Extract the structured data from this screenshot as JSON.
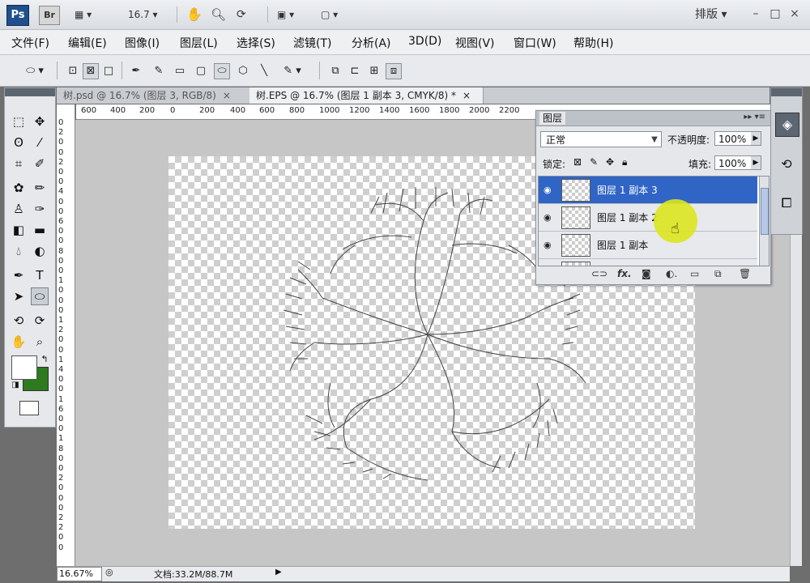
{
  "appbar": {
    "ps_label": "Ps",
    "br_label": "Br",
    "zoom": "16.7",
    "workspace": "排版",
    "win_min": "–",
    "win_max": "□",
    "win_close": "×"
  },
  "menu": [
    "文件(F)",
    "编辑(E)",
    "图像(I)",
    "图层(L)",
    "选择(S)",
    "滤镜(T)",
    "分析(A)",
    "3D(D)",
    "视图(V)",
    "窗口(W)",
    "帮助(H)"
  ],
  "tabs": [
    {
      "label": "树.psd @ 16.7% (图层 3, RGB/8)",
      "close": "×"
    },
    {
      "label": "树.EPS @ 16.7% (图层 1 副本 3, CMYK/8) *",
      "close": "×"
    }
  ],
  "ruler_top": [
    "600",
    "400",
    "200",
    "0",
    "200",
    "400",
    "600",
    "800",
    "1000",
    "1200",
    "1400",
    "1600",
    "1800",
    "2000",
    "2200"
  ],
  "ruler_left": [
    "0",
    "2",
    "0",
    "0",
    "2",
    "0",
    "0",
    "4",
    "0",
    "0",
    "6",
    "0",
    "0",
    "8",
    "0",
    "0",
    "1",
    "0",
    "0",
    "0",
    "1",
    "2",
    "0",
    "0",
    "1",
    "4",
    "0",
    "0",
    "1",
    "6",
    "0",
    "0",
    "1",
    "8",
    "0",
    "0",
    "2",
    "0",
    "0",
    "0",
    "2",
    "2",
    "0",
    "0"
  ],
  "status": {
    "zoom": "16.67%",
    "doc": "文档:33.2M/88.7M",
    "arrow": "▶"
  },
  "layers_panel": {
    "title": "图层",
    "blend_mode": "正常",
    "opacity_label": "不透明度:",
    "opacity": "100%",
    "lock_label": "锁定:",
    "fill_label": "填充:",
    "fill": "100%",
    "layers": [
      {
        "name": "图层 1 副本 3",
        "selected": true
      },
      {
        "name": "图层 1 副本 2",
        "selected": false
      },
      {
        "name": "图层 1 副本",
        "selected": false
      }
    ],
    "footer_icons": [
      "link-icon",
      "fx-icon",
      "mask-icon",
      "adjustment-icon",
      "group-icon",
      "new-layer-icon",
      "trash-icon"
    ],
    "footer_fx": "fx."
  },
  "tools": {
    "type_tool": "T"
  },
  "colors": {
    "foreground": "#ffffff",
    "background": "#2d7a1f",
    "selected_layer": "#3065c6"
  }
}
